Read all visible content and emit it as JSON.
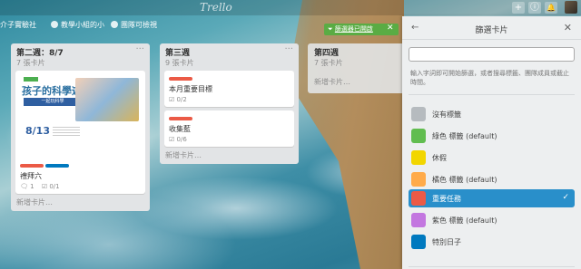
{
  "topbar": {
    "logo": "Trello",
    "buttons": [
      "+",
      "ⓘ",
      "🔔"
    ]
  },
  "board_header": {
    "title": "介子實驗社",
    "team": "教學小組的小",
    "visibility": "團隊可檢視"
  },
  "filter_button": {
    "prefix": "",
    "label": "篩選器已開啟",
    "close": "✕"
  },
  "lists": [
    {
      "title": "第二週：8/7",
      "count": "7 張卡片",
      "menu": "···",
      "cards": [
        {
          "has_poster": true,
          "poster_title": "孩子的科學遊戲",
          "poster_sub": "一起玩科學",
          "poster_date": "8/13",
          "labels": [
            "#eb5a46",
            "#0079bf"
          ],
          "title": "禮拜六",
          "badges": [
            {
              "icon": "comment-icon",
              "text": "1"
            },
            {
              "icon": "checklist-icon",
              "text": "0/1"
            }
          ]
        }
      ],
      "add": "新增卡片…"
    },
    {
      "title": "第三週",
      "count": "9 張卡片",
      "menu": "···",
      "cards": [
        {
          "labels": [
            "#eb5a46"
          ],
          "title": "本月重要目標",
          "badges": [
            {
              "icon": "checklist-icon",
              "text": "0/2"
            }
          ]
        },
        {
          "labels": [
            "#eb5a46"
          ],
          "title": "收集藍",
          "badges": [
            {
              "icon": "checklist-icon",
              "text": "0/6"
            }
          ]
        }
      ],
      "add": "新增卡片…"
    },
    {
      "title": "第四週",
      "count": "7 張卡片",
      "menu": "···",
      "cards": [],
      "add": "新增卡片…"
    }
  ],
  "panel": {
    "back": "←",
    "title": "篩選卡片",
    "close": "✕",
    "search_value": "",
    "search_placeholder": "",
    "help": "輸入字詞即可開始篩選，或者搜尋標籤、團隊成員或截止時間。",
    "labels": [
      {
        "name": "沒有標籤",
        "color": "#b6bbbf",
        "active": false
      },
      {
        "name": "綠色 標籤 (default)",
        "color": "#61bd4f",
        "active": false
      },
      {
        "name": "休假",
        "color": "#f2d600",
        "active": false
      },
      {
        "name": "橘色 標籤 (default)",
        "color": "#ffab4a",
        "active": false
      },
      {
        "name": "重要任務",
        "color": "#eb5a46",
        "active": true
      },
      {
        "name": "紫色 標籤 (default)",
        "color": "#c377e0",
        "active": false
      },
      {
        "name": "特別日子",
        "color": "#0079bf",
        "active": false
      }
    ],
    "check": "✓"
  },
  "colors": {
    "active_row": "#298fca",
    "filter_green": "#5aac44"
  }
}
